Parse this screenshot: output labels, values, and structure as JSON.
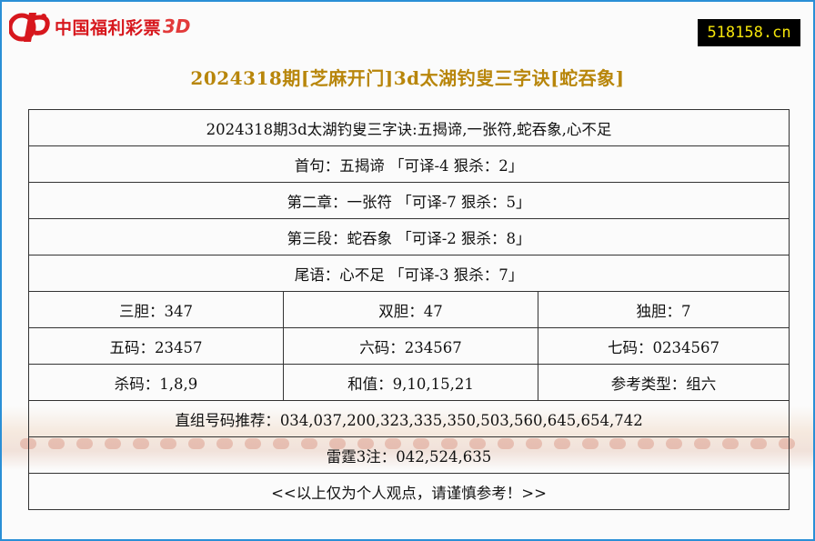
{
  "brand": {
    "name": "中国福利彩票",
    "suffix": "3D"
  },
  "site_badge": "518158.cn",
  "page_title": "2024318期[芝麻开门]3d太湖钓叟三字诀[蛇吞象]",
  "rows": {
    "header": "2024318期3d太湖钓叟三字诀:五揭谛,一张符,蛇吞象,心不足",
    "line1": "首句：五揭谛 「可译-4 狠杀：2」",
    "line2": "第二章：一张符 「可译-7 狠杀：5」",
    "line3": "第三段：蛇吞象 「可译-2 狠杀：8」",
    "line4": "尾语：心不足 「可译-3 狠杀：7」",
    "three_dan": "三胆：347",
    "two_dan": "双胆：47",
    "one_dan": "独胆：7",
    "five_code": "五码：23457",
    "six_code": "六码：234567",
    "seven_code": "七码：0234567",
    "kill_code": "杀码：1,8,9",
    "sum_value": "和值：9,10,15,21",
    "ref_type": "参考类型：组六",
    "direct_group": "直组号码推荐：034,037,200,323,335,350,503,560,645,654,742",
    "thunder": "雷霆3注：042,524,635",
    "disclaimer": "<<以上仅为个人观点，请谨慎参考！>>"
  },
  "colors": {
    "border": "#2a8fd6",
    "title": "#b8860b",
    "brand_red": "#d7171d",
    "badge_bg": "#000000",
    "badge_text": "#f4e40a"
  }
}
